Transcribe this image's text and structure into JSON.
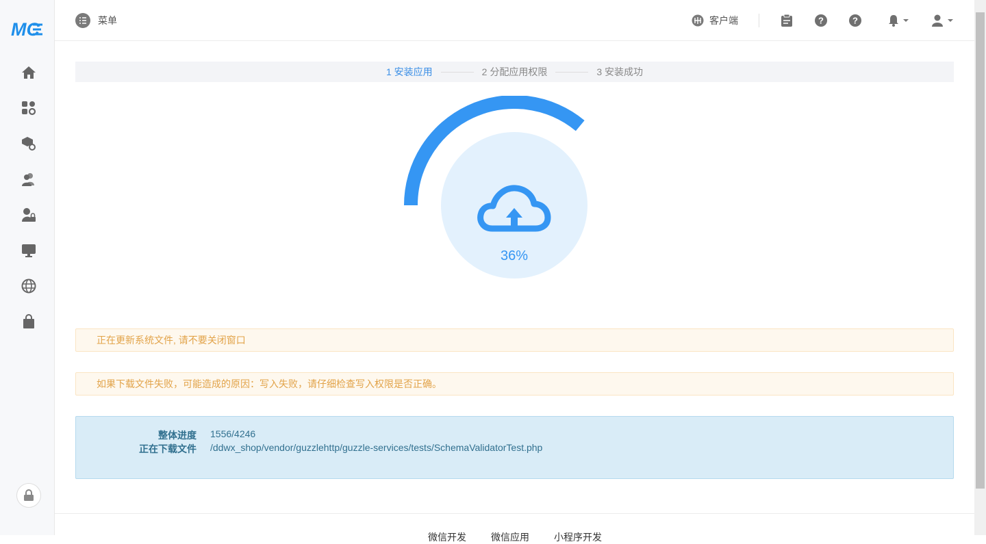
{
  "header": {
    "menu_label": "菜单",
    "client_label": "客户端"
  },
  "logo_text": "MC",
  "steps": [
    {
      "label": "1 安装应用",
      "active": true
    },
    {
      "label": "2 分配应用权限",
      "active": false
    },
    {
      "label": "3 安装成功",
      "active": false
    }
  ],
  "progress": {
    "percent_label": "36%",
    "value": 0.36
  },
  "notices": [
    "正在更新系统文件, 请不要关闭窗口",
    "如果下载文件失败，可能造成的原因：写入失败，请仔细检查写入权限是否正确。"
  ],
  "info": {
    "overall_label": "整体进度",
    "overall_value": "1556/4246",
    "downloading_label": "正在下载文件",
    "downloading_value": "/ddwx_shop/vendor/guzzlehttp/guzzle-services/tests/SchemaValidatorTest.php"
  },
  "footer": {
    "links": [
      "微信开发",
      "微信应用",
      "小程序开发"
    ]
  },
  "colors": {
    "accent": "#3596f3",
    "circle_bg": "#e3f1fd",
    "notice_text": "#e2a349",
    "info_text": "#31708f"
  },
  "sidebar_icons": [
    "home-icon",
    "apps-settings-icon",
    "package-settings-icon",
    "users-icon",
    "user-lock-icon",
    "monitor-icon",
    "globe-icon",
    "bag-icon"
  ]
}
